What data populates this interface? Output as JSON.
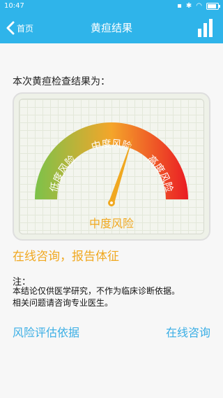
{
  "status_bar": {
    "time": "10:47",
    "battery_level": 0.85
  },
  "header": {
    "back_label": "首页",
    "title": "黄疸结果"
  },
  "result": {
    "heading": "本次黄疸检查结果为：",
    "risk_label": "中度风险"
  },
  "gauge": {
    "segments": [
      {
        "label": "低度风险",
        "color": "#7cc24a"
      },
      {
        "label": "中度风险",
        "color": "#f4a52a"
      },
      {
        "label": "高度风险",
        "color": "#ea1c24"
      }
    ],
    "needle_value": 0.6
  },
  "consult_link": "在线咨询，报告体征",
  "note": {
    "title": "注：",
    "lines": [
      "本结论仅供医学研究，不作为临床诊断依据。",
      "相关问题请咨询专业医生。"
    ]
  },
  "footer": {
    "left_link": "风险评估依据",
    "right_link": "在线咨询"
  }
}
